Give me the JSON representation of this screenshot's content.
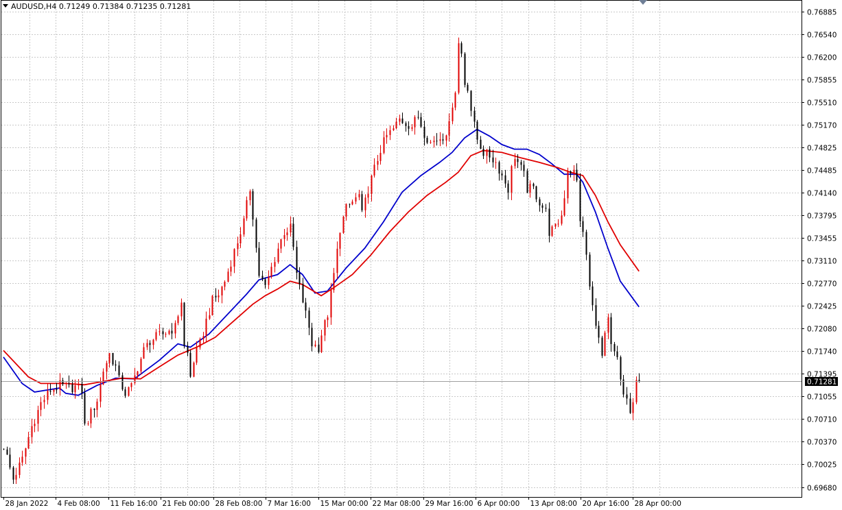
{
  "window": {
    "symbol": "AUDUSD,H4",
    "open": "0.71249",
    "high": "0.71384",
    "low": "0.71235",
    "close": "0.71281",
    "current_price_label": "0.71281"
  },
  "colors": {
    "background": "#ffffff",
    "grid": "#c8c8c8",
    "bull_candle": "#e00000",
    "bear_candle": "#000000",
    "ma_fast": "#0000cc",
    "ma_slow": "#e00000",
    "price_tag_bg": "#000000",
    "price_tag_text": "#ffffff"
  },
  "chart_data": {
    "type": "candlestick",
    "symbol": "AUDUSD",
    "timeframe": "H4",
    "grid": true,
    "ylim": [
      0.6953,
      0.7705
    ],
    "y_ticks": [
      "0.76885",
      "0.76540",
      "0.76200",
      "0.75855",
      "0.75510",
      "0.75170",
      "0.74825",
      "0.74485",
      "0.74140",
      "0.73795",
      "0.73455",
      "0.73110",
      "0.72770",
      "0.72425",
      "0.72080",
      "0.71740",
      "0.71395",
      "0.71055",
      "0.70710",
      "0.70370",
      "0.70025",
      "0.69680"
    ],
    "x_ticks": [
      "28 Jan 2022",
      "4 Feb 08:00",
      "11 Feb 16:00",
      "21 Feb 00:00",
      "28 Feb 08:00",
      "7 Mar 16:00",
      "15 Mar 00:00",
      "22 Mar 08:00",
      "29 Mar 16:00",
      "6 Apr 00:00",
      "13 Apr 08:00",
      "20 Apr 16:00",
      "28 Apr 00:00"
    ],
    "current_price": 0.71281,
    "close_path": [
      [
        0,
        0.703
      ],
      [
        3,
        0.698
      ],
      [
        6,
        0.701
      ],
      [
        9,
        0.706
      ],
      [
        12,
        0.7095
      ],
      [
        15,
        0.7115
      ],
      [
        18,
        0.7122
      ],
      [
        21,
        0.7118
      ],
      [
        23,
        0.712
      ],
      [
        25,
        0.7115
      ],
      [
        26,
        0.706
      ],
      [
        28,
        0.708
      ],
      [
        30,
        0.71
      ],
      [
        32,
        0.7145
      ],
      [
        34,
        0.717
      ],
      [
        36,
        0.715
      ],
      [
        37,
        0.713
      ],
      [
        39,
        0.711
      ],
      [
        41,
        0.712
      ],
      [
        43,
        0.715
      ],
      [
        45,
        0.7175
      ],
      [
        47,
        0.719
      ],
      [
        49,
        0.7195
      ],
      [
        51,
        0.72
      ],
      [
        53,
        0.7205
      ],
      [
        55,
        0.721
      ],
      [
        57,
        0.725
      ],
      [
        58,
        0.718
      ],
      [
        59,
        0.717
      ],
      [
        60,
        0.7135
      ],
      [
        61,
        0.716
      ],
      [
        63,
        0.7185
      ],
      [
        65,
        0.722
      ],
      [
        67,
        0.725
      ],
      [
        69,
        0.726
      ],
      [
        71,
        0.728
      ],
      [
        73,
        0.731
      ],
      [
        75,
        0.734
      ],
      [
        77,
        0.737
      ],
      [
        79,
        0.742
      ],
      [
        80,
        0.738
      ],
      [
        81,
        0.733
      ],
      [
        82,
        0.729
      ],
      [
        84,
        0.727
      ],
      [
        86,
        0.73
      ],
      [
        88,
        0.733
      ],
      [
        90,
        0.7355
      ],
      [
        92,
        0.736
      ],
      [
        93,
        0.733
      ],
      [
        94,
        0.729
      ],
      [
        96,
        0.725
      ],
      [
        98,
        0.721
      ],
      [
        99,
        0.7185
      ],
      [
        101,
        0.718
      ],
      [
        102,
        0.72
      ],
      [
        104,
        0.723
      ],
      [
        106,
        0.729
      ],
      [
        108,
        0.736
      ],
      [
        110,
        0.739
      ],
      [
        112,
        0.74
      ],
      [
        114,
        0.741
      ],
      [
        115,
        0.738
      ],
      [
        117,
        0.742
      ],
      [
        119,
        0.745
      ],
      [
        121,
        0.748
      ],
      [
        123,
        0.75
      ],
      [
        125,
        0.751
      ],
      [
        127,
        0.7525
      ],
      [
        129,
        0.752
      ],
      [
        131,
        0.7515
      ],
      [
        133,
        0.753
      ],
      [
        135,
        0.7505
      ],
      [
        137,
        0.749
      ],
      [
        139,
        0.7495
      ],
      [
        141,
        0.75
      ],
      [
        143,
        0.7515
      ],
      [
        144,
        0.755
      ],
      [
        145,
        0.757
      ],
      [
        146,
        0.764
      ],
      [
        147,
        0.7625
      ],
      [
        148,
        0.758
      ],
      [
        149,
        0.7575
      ],
      [
        150,
        0.754
      ],
      [
        151,
        0.7515
      ],
      [
        152,
        0.7495
      ],
      [
        154,
        0.7475
      ],
      [
        156,
        0.747
      ],
      [
        158,
        0.746
      ],
      [
        160,
        0.744
      ],
      [
        162,
        0.742
      ],
      [
        163,
        0.745
      ],
      [
        164,
        0.747
      ],
      [
        165,
        0.746
      ],
      [
        167,
        0.744
      ],
      [
        168,
        0.742
      ],
      [
        170,
        0.742
      ],
      [
        172,
        0.74
      ],
      [
        174,
        0.7385
      ],
      [
        175,
        0.7355
      ],
      [
        177,
        0.736
      ],
      [
        179,
        0.738
      ],
      [
        180,
        0.741
      ],
      [
        181,
        0.745
      ],
      [
        183,
        0.7445
      ],
      [
        184,
        0.743
      ],
      [
        185,
        0.7375
      ],
      [
        186,
        0.735
      ],
      [
        187,
        0.732
      ],
      [
        188,
        0.727
      ],
      [
        189,
        0.724
      ],
      [
        190,
        0.722
      ],
      [
        191,
        0.719
      ],
      [
        192,
        0.7165
      ],
      [
        193,
        0.7195
      ],
      [
        194,
        0.722
      ],
      [
        195,
        0.718
      ],
      [
        196,
        0.717
      ],
      [
        197,
        0.716
      ],
      [
        198,
        0.713
      ],
      [
        199,
        0.711
      ],
      [
        200,
        0.71
      ],
      [
        201,
        0.708
      ],
      [
        202,
        0.709
      ],
      [
        203,
        0.7127
      ],
      [
        204,
        0.71281
      ]
    ],
    "series": [
      {
        "color": "#0000cc",
        "points": [
          [
            0,
            0.7165
          ],
          [
            6,
            0.7125
          ],
          [
            10,
            0.7112
          ],
          [
            18,
            0.7118
          ],
          [
            20,
            0.711
          ],
          [
            24,
            0.7107
          ],
          [
            30,
            0.7122
          ],
          [
            36,
            0.7133
          ],
          [
            42,
            0.7132
          ],
          [
            50,
            0.716
          ],
          [
            56,
            0.7185
          ],
          [
            60,
            0.718
          ],
          [
            66,
            0.72
          ],
          [
            72,
            0.723
          ],
          [
            78,
            0.726
          ],
          [
            82,
            0.7282
          ],
          [
            88,
            0.729
          ],
          [
            92,
            0.7305
          ],
          [
            96,
            0.729
          ],
          [
            100,
            0.7262
          ],
          [
            104,
            0.7265
          ],
          [
            110,
            0.73
          ],
          [
            116,
            0.733
          ],
          [
            122,
            0.737
          ],
          [
            128,
            0.7415
          ],
          [
            134,
            0.744
          ],
          [
            140,
            0.746
          ],
          [
            144,
            0.7475
          ],
          [
            148,
            0.7497
          ],
          [
            152,
            0.751
          ],
          [
            156,
            0.75
          ],
          [
            160,
            0.7487
          ],
          [
            164,
            0.748
          ],
          [
            168,
            0.748
          ],
          [
            172,
            0.7472
          ],
          [
            176,
            0.7458
          ],
          [
            180,
            0.7442
          ],
          [
            184,
            0.7442
          ],
          [
            186,
            0.743
          ],
          [
            190,
            0.7385
          ],
          [
            194,
            0.733
          ],
          [
            198,
            0.728
          ],
          [
            204,
            0.7241
          ]
        ]
      },
      {
        "color": "#e00000",
        "points": [
          [
            0,
            0.7175
          ],
          [
            8,
            0.7135
          ],
          [
            12,
            0.7125
          ],
          [
            20,
            0.7125
          ],
          [
            26,
            0.7123
          ],
          [
            32,
            0.7128
          ],
          [
            38,
            0.7133
          ],
          [
            44,
            0.7132
          ],
          [
            50,
            0.715
          ],
          [
            56,
            0.7168
          ],
          [
            62,
            0.718
          ],
          [
            68,
            0.7195
          ],
          [
            74,
            0.722
          ],
          [
            80,
            0.7245
          ],
          [
            84,
            0.7258
          ],
          [
            88,
            0.7268
          ],
          [
            92,
            0.728
          ],
          [
            96,
            0.7275
          ],
          [
            102,
            0.7258
          ],
          [
            106,
            0.727
          ],
          [
            112,
            0.729
          ],
          [
            118,
            0.732
          ],
          [
            124,
            0.7355
          ],
          [
            130,
            0.7385
          ],
          [
            136,
            0.741
          ],
          [
            142,
            0.743
          ],
          [
            146,
            0.7445
          ],
          [
            150,
            0.747
          ],
          [
            154,
            0.7478
          ],
          [
            160,
            0.7475
          ],
          [
            166,
            0.7467
          ],
          [
            172,
            0.746
          ],
          [
            178,
            0.7452
          ],
          [
            182,
            0.7445
          ],
          [
            186,
            0.744
          ],
          [
            190,
            0.741
          ],
          [
            194,
            0.737
          ],
          [
            198,
            0.7335
          ],
          [
            204,
            0.7295
          ]
        ]
      }
    ]
  }
}
